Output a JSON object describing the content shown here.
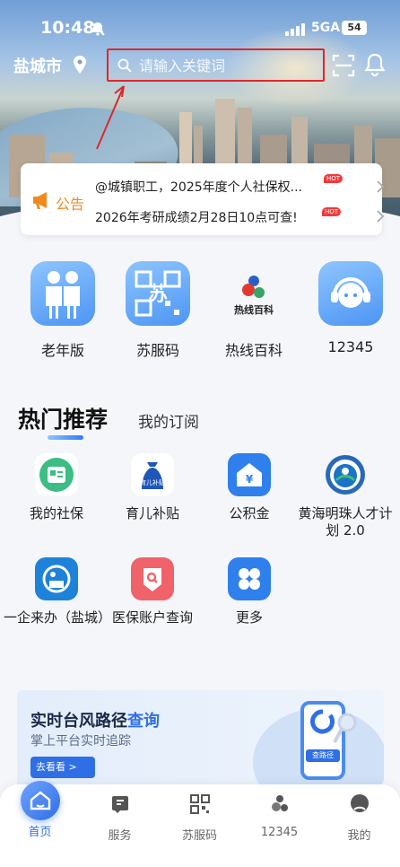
{
  "status_bar": {
    "time": "10:48",
    "network": "5GA",
    "battery": "54"
  },
  "header": {
    "city": "盐城市",
    "search_placeholder": "请输入关键词"
  },
  "notices": {
    "label": "公告",
    "items": [
      {
        "text": "@城镇职工，2025年度个人社保权...",
        "badge": "HOT"
      },
      {
        "text": "2026年考研成绩2月28日10点可查!",
        "badge": "HOT"
      }
    ]
  },
  "top_apps": [
    {
      "label": "老年版",
      "icon": "elderly-couple-icon"
    },
    {
      "label": "苏服码",
      "icon": "qr-code-icon"
    },
    {
      "label": "热线百科",
      "icon": "hotline-wiki-logo",
      "logo_text": "热线百科"
    },
    {
      "label": "12345",
      "icon": "headset-icon"
    }
  ],
  "recommend": {
    "tab_active": "热门推荐",
    "tab_other": "我的订阅",
    "services": [
      {
        "label": "我的社保",
        "icon": "social-security-icon"
      },
      {
        "label": "育儿补贴",
        "icon": "childcare-subsidy-icon",
        "icon_text": "育儿补贴"
      },
      {
        "label": "公积金",
        "icon": "housing-fund-icon"
      },
      {
        "label": "黄海明珠人才计划 2.0",
        "icon": "talent-plan-logo"
      },
      {
        "label": "一企来办（盐城）",
        "icon": "enterprise-icon"
      },
      {
        "label": "医保账户查询",
        "icon": "medical-insurance-icon"
      },
      {
        "label": "更多",
        "icon": "more-grid-icon"
      }
    ]
  },
  "banner": {
    "title_prefix": "实时台风路径",
    "title_highlight": "查询",
    "subtitle": "掌上平台实时追踪",
    "button": "去看看 >",
    "phone_button": "查路径"
  },
  "tabbar": {
    "items": [
      {
        "label": "首页",
        "icon": "home-icon",
        "active": true
      },
      {
        "label": "服务",
        "icon": "service-icon",
        "active": false
      },
      {
        "label": "苏服码",
        "icon": "qr-code-icon",
        "active": false
      },
      {
        "label": "12345",
        "icon": "hotline-icon",
        "active": false
      },
      {
        "label": "我的",
        "icon": "profile-icon",
        "active": false
      }
    ]
  },
  "colors": {
    "accent": "#2f6fe6",
    "notice": "#f08a1e",
    "hot": "#f23a3a"
  }
}
